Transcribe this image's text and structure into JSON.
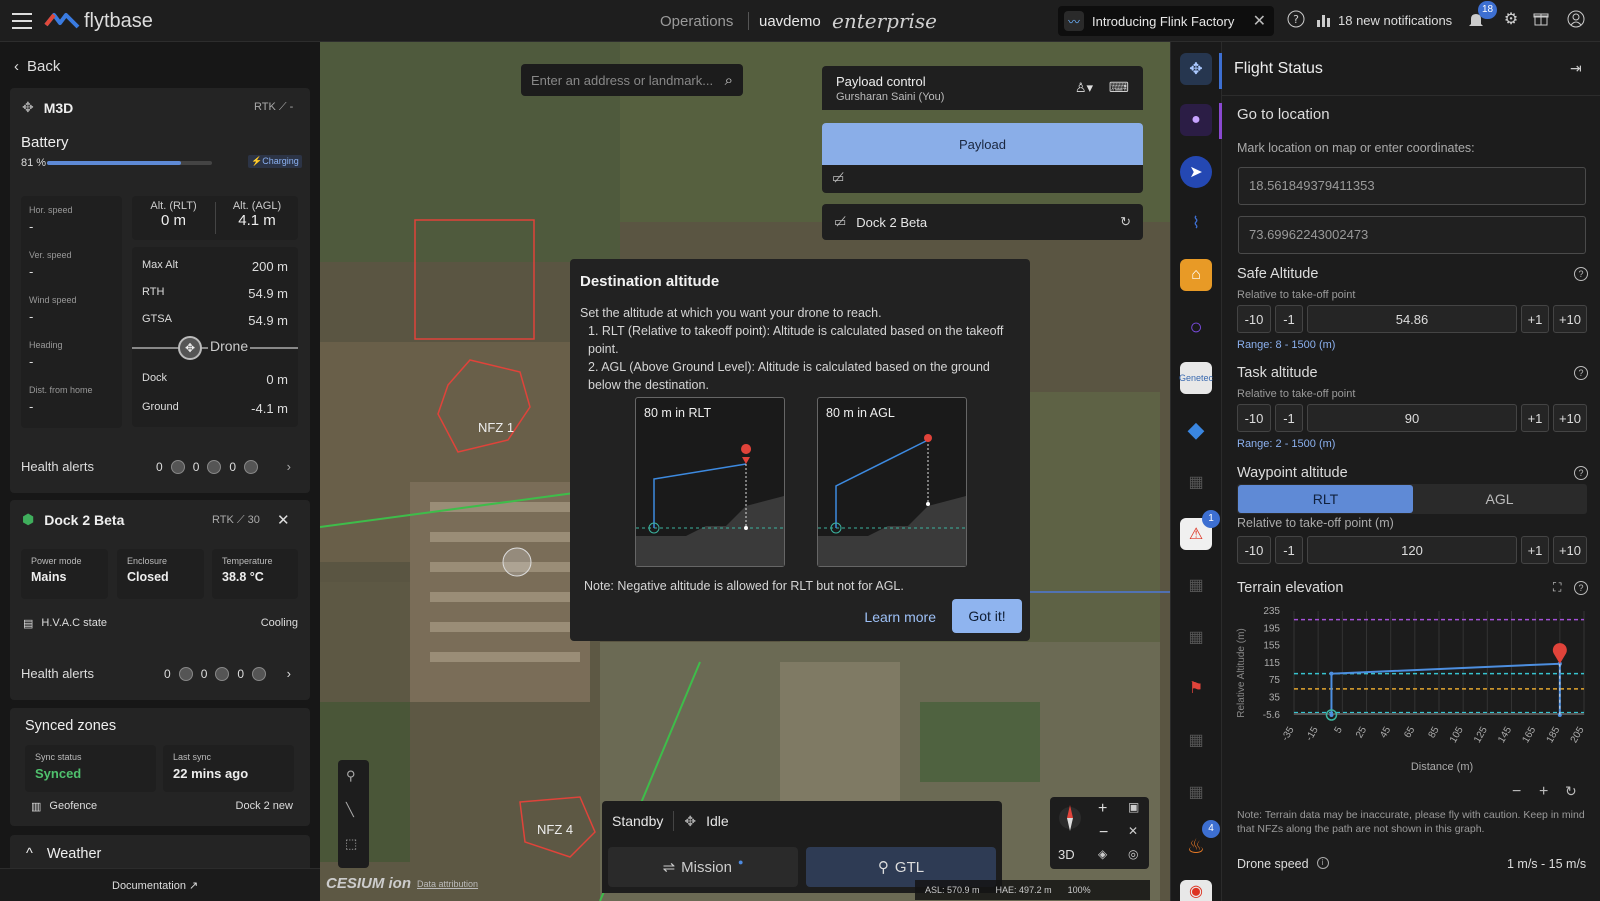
{
  "topbar": {
    "logo": "flytbase",
    "operations": "Operations",
    "org": "uavdemo",
    "edition": "enterprise",
    "banner": "Introducing Flink Factory",
    "notifications_text": "18 new notifications",
    "notifications_badge": "18"
  },
  "left": {
    "back": "Back",
    "drone_name": "M3D",
    "rtk_label": "RTK",
    "rtk_value": "-",
    "battery_title": "Battery",
    "battery_pct": "81 %",
    "battery_level": 0.81,
    "battery_status": "Charging",
    "hor_speed_label": "Hor. speed",
    "hor_speed": "-",
    "ver_speed_label": "Ver. speed",
    "ver_speed": "-",
    "wind_label": "Wind speed",
    "wind": "-",
    "heading_label": "Heading",
    "heading": "-",
    "dist_label": "Dist. from home",
    "dist": "-",
    "alt_rlt_label": "Alt. (RLT)",
    "alt_rlt": "0 m",
    "alt_agl_label": "Alt. (AGL)",
    "alt_agl": "4.1 m",
    "max_alt_label": "Max Alt",
    "max_alt": "200 m",
    "rth_label": "RTH",
    "rth": "54.9 m",
    "gtsa_label": "GTSA",
    "gtsa": "54.9 m",
    "drone_marker": "Drone",
    "dock_label": "Dock",
    "dock": "0 m",
    "ground_label": "Ground",
    "ground": "-4.1 m",
    "health_label": "Health alerts",
    "h1": "0",
    "h2": "0",
    "h3": "0",
    "dock_name": "Dock 2 Beta",
    "dock_rtk": "RTK",
    "dock_rtk_val": "30",
    "power_label": "Power mode",
    "power": "Mains",
    "enclosure_label": "Enclosure",
    "enclosure": "Closed",
    "temp_label": "Temperature",
    "temp": "38.8 °C",
    "hvac_label": "H.V.A.C state",
    "hvac": "Cooling",
    "health2_label": "Health alerts",
    "d1": "0",
    "d2": "0",
    "d3": "0",
    "synced_title": "Synced zones",
    "sync_status_label": "Sync status",
    "sync_status": "Synced",
    "last_sync_label": "Last sync",
    "last_sync": "22 mins ago",
    "geofence_label": "Geofence",
    "geofence": "Dock 2 new",
    "weather": "Weather",
    "documentation": "Documentation"
  },
  "map": {
    "search_placeholder": "Enter an address or landmark...",
    "payload_control": "Payload control",
    "payload_user": "Gursharan Saini (You)",
    "payload_btn": "Payload",
    "dock_bar": "Dock 2 Beta",
    "nfz1": "NFZ 1",
    "nfz4": "NFZ 4",
    "standby": "Standby",
    "idle": "Idle",
    "mission": "Mission",
    "gtl": "GTL",
    "view3d": "3D",
    "cesium": "CESIUM ion",
    "data_attr": "Data attribution",
    "asl": "ASL: 570.9 m",
    "hae": "HAE: 497.2 m",
    "zoom": "100%"
  },
  "dialog": {
    "title": "Destination altitude",
    "intro": "Set the altitude at which you want your drone to reach.",
    "p1": "1. RLT (Relative to takeoff point): Altitude is calculated based on the takeoff point.",
    "p2": "2. AGL (Above Ground Level): Altitude is calculated based on the ground below the destination.",
    "ill1": "80 m in RLT",
    "ill2": "80 m in AGL",
    "note": "Note: Negative altitude is allowed for RLT but not for AGL.",
    "learn_more": "Learn more",
    "got_it": "Got it!"
  },
  "rail": {
    "badge1": "1",
    "badge2": "4",
    "genetec": "Genetec"
  },
  "right": {
    "title": "Flight Status",
    "goto": "Go to location",
    "mark": "Mark location on map or enter coordinates:",
    "lat": "18.561849379411353",
    "lon": "73.69962243002473",
    "safe_title": "Safe Altitude",
    "rel": "Relative to take-off point",
    "safe_value": "54.86",
    "safe_range": "Range: 8 - 1500 (m)",
    "task_title": "Task altitude",
    "task_value": "90",
    "task_range": "Range: 2 - 1500 (m)",
    "wp_title": "Waypoint altitude",
    "rlt": "RLT",
    "agl": "AGL",
    "rel_m": "Relative to take-off point (m)",
    "wp_value": "120",
    "m10": "-10",
    "m1": "-1",
    "p1": "+1",
    "p10": "+10",
    "terrain_title": "Terrain elevation",
    "terrain_note": "Note: Terrain data may be inaccurate, please fly with caution. Keep in mind that NFZs along the path are not shown in this graph.",
    "speed_label": "Drone speed",
    "speed_value": "1 m/s - 15 m/s"
  },
  "chart_data": {
    "type": "line",
    "xlabel": "Distance (m)",
    "ylabel": "Relative Altitude (m)",
    "y_ticks": [
      "235",
      "195",
      "155",
      "115",
      "75",
      "35",
      "-5.6"
    ],
    "x_ticks": [
      "-35",
      "-15",
      "5",
      "25",
      "45",
      "65",
      "85",
      "105",
      "125",
      "145",
      "165",
      "185",
      "205"
    ],
    "series": [
      {
        "x": [
          -4,
          -4,
          185,
          185
        ],
        "y": [
          -5.6,
          90,
          113,
          -5.6
        ]
      }
    ],
    "reference_lines": [
      {
        "color": "#a451d8",
        "y": 215
      },
      {
        "color": "#37c3cf",
        "y": 90
      },
      {
        "color": "#e3a52f",
        "y": 54.86
      },
      {
        "color": "#37c3cf",
        "y": 0
      }
    ]
  }
}
